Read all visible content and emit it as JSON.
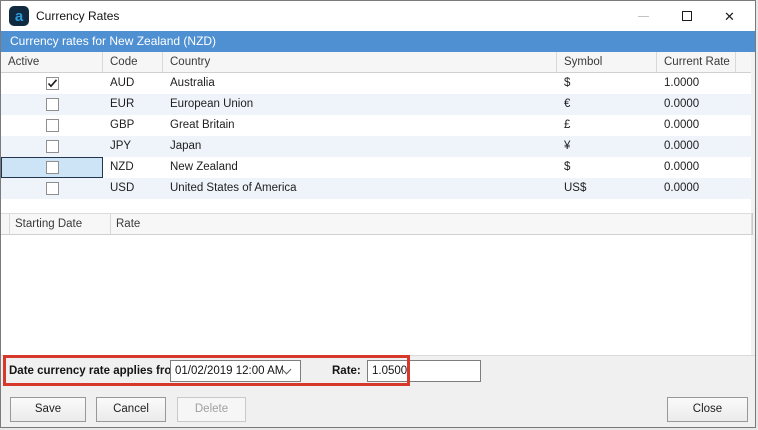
{
  "window": {
    "title": "Currency Rates",
    "icon_letter": "a"
  },
  "banner": {
    "text": "Currency rates for New Zealand (NZD)"
  },
  "currency_table": {
    "columns": {
      "active": "Active",
      "code": "Code",
      "country": "Country",
      "symbol": "Symbol",
      "current_rate": "Current Rate"
    },
    "rows": [
      {
        "active": true,
        "code": "AUD",
        "country": "Australia",
        "symbol": "$",
        "current_rate": "1.0000",
        "selected": false
      },
      {
        "active": false,
        "code": "EUR",
        "country": "European Union",
        "symbol": "€",
        "current_rate": "0.0000",
        "selected": false
      },
      {
        "active": false,
        "code": "GBP",
        "country": "Great Britain",
        "symbol": "£",
        "current_rate": "0.0000",
        "selected": false
      },
      {
        "active": false,
        "code": "JPY",
        "country": "Japan",
        "symbol": "¥",
        "current_rate": "0.0000",
        "selected": false
      },
      {
        "active": false,
        "code": "NZD",
        "country": "New Zealand",
        "symbol": "$",
        "current_rate": "0.0000",
        "selected": true
      },
      {
        "active": false,
        "code": "USD",
        "country": "United States of America",
        "symbol": "US$",
        "current_rate": "0.0000",
        "selected": false
      }
    ]
  },
  "history_table": {
    "columns": {
      "starting_date": "Starting Date",
      "rate": "Rate"
    },
    "rows": []
  },
  "entry": {
    "date_label": "Date currency rate applies from:",
    "date_value": "01/02/2019 12:00 AM",
    "rate_label": "Rate:",
    "rate_value": "1.0500"
  },
  "buttons": {
    "save": "Save",
    "cancel": "Cancel",
    "delete": "Delete",
    "close": "Close"
  },
  "colors": {
    "banner_bg": "#4e90d2",
    "row_alt_bg": "#eef4fa",
    "selected_cell_bg": "#cde3f6",
    "annotation_red": "#d6382c"
  }
}
